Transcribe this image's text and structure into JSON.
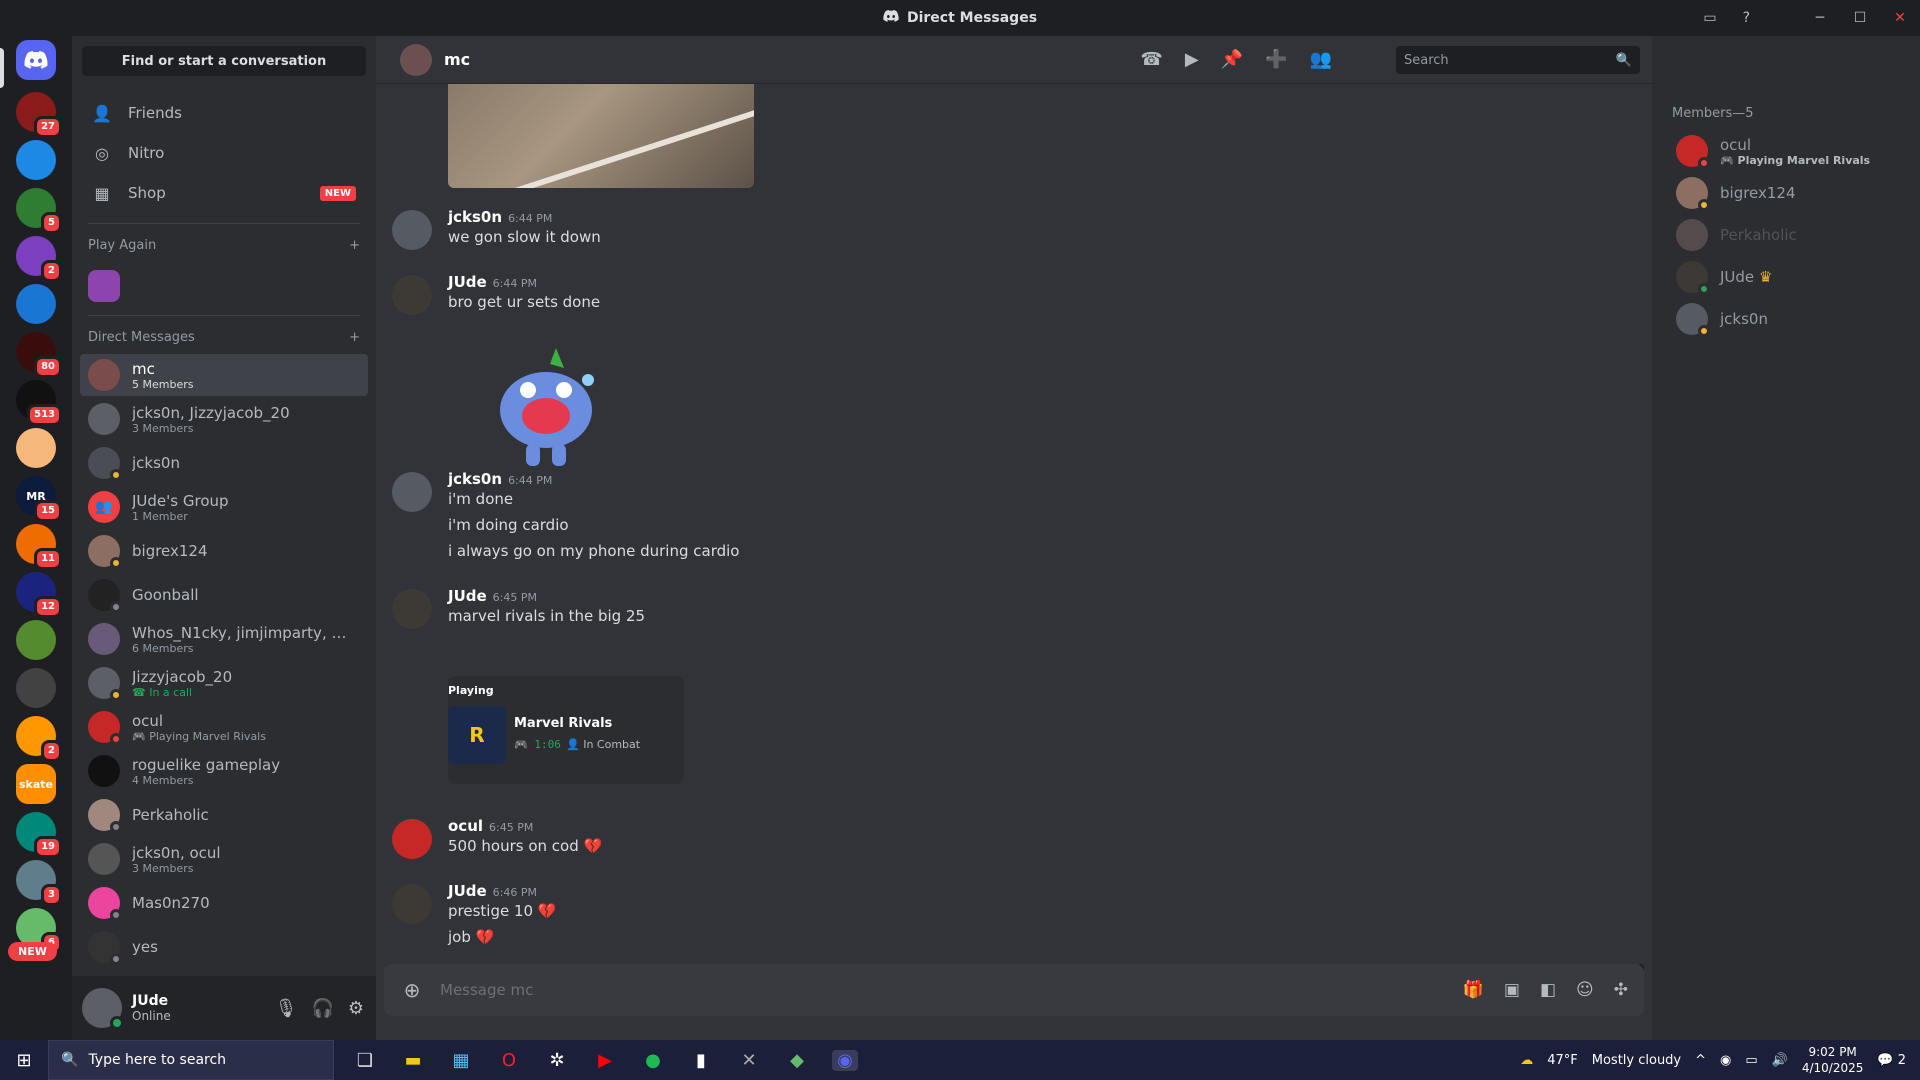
{
  "window": {
    "title": "Direct Messages"
  },
  "sidebar": {
    "find_placeholder": "Find or start a conversation",
    "nav": [
      {
        "label": "Friends"
      },
      {
        "label": "Nitro"
      },
      {
        "label": "Shop",
        "badge": "NEW"
      }
    ],
    "play_again_header": "Play Again",
    "dm_header": "Direct Messages",
    "dms": [
      {
        "name": "mc",
        "sub": "5 Members"
      },
      {
        "name": "jcks0n, Jizzyjacob_20",
        "sub": "3 Members"
      },
      {
        "name": "jcks0n",
        "sub": ""
      },
      {
        "name": "JUde's Group",
        "sub": "1 Member"
      },
      {
        "name": "bigrex124",
        "sub": ""
      },
      {
        "name": "Goonball",
        "sub": ""
      },
      {
        "name": "Whos_N1cky, jimjimparty, Luc...",
        "sub": "6 Members"
      },
      {
        "name": "Jizzyjacob_20",
        "sub": "In a call"
      },
      {
        "name": "ocul",
        "sub": "Playing Marvel Rivals"
      },
      {
        "name": "roguelike gameplay",
        "sub": "4 Members"
      },
      {
        "name": "Perkaholic",
        "sub": ""
      },
      {
        "name": "jcks0n, ocul",
        "sub": "3 Members"
      },
      {
        "name": "Mas0n270",
        "sub": ""
      },
      {
        "name": "yes",
        "sub": ""
      }
    ]
  },
  "guild_badges": [
    "27",
    "5",
    "2",
    "80",
    "513",
    "15",
    "11",
    "12",
    "2",
    "19",
    "3",
    "6"
  ],
  "guild_labels": {
    "skate": "skate",
    "new": "NEW",
    "mr": "MR"
  },
  "user": {
    "name": "JUde",
    "status": "Online"
  },
  "chat": {
    "name": "mc",
    "search_placeholder": "Search",
    "composer_placeholder": "Message mc",
    "messages": [
      {
        "author": "jcks0n",
        "time": "6:44 PM",
        "lines": [
          "we gon slow it down"
        ]
      },
      {
        "author": "JUde",
        "time": "6:44 PM",
        "lines": [
          "bro get ur sets done"
        ]
      },
      {
        "author": "jcks0n",
        "time": "6:44 PM",
        "lines": [
          "i'm done",
          "i'm doing cardio",
          "i always go on my phone during cardio"
        ]
      },
      {
        "author": "JUde",
        "time": "6:45 PM",
        "lines": [
          "marvel rivals in the big 25"
        ]
      },
      {
        "author": "ocul",
        "time": "6:45 PM",
        "lines": [
          "500 hours on cod"
        ]
      },
      {
        "author": "JUde",
        "time": "6:46 PM",
        "lines": [
          "prestige 10",
          "job"
        ]
      }
    ],
    "activity": {
      "label": "Playing",
      "game": "Marvel Rivals",
      "elapsed": "1:06",
      "state": "In Combat"
    }
  },
  "members": {
    "header": "Members—5",
    "list": [
      {
        "name": "ocul",
        "activity": "Playing Marvel Rivals"
      },
      {
        "name": "bigrex124",
        "activity": ""
      },
      {
        "name": "Perkaholic",
        "activity": ""
      },
      {
        "name": "JUde",
        "activity": ""
      },
      {
        "name": "jcks0n",
        "activity": ""
      }
    ]
  },
  "taskbar": {
    "search_placeholder": "Type here to search",
    "weather_temp": "47°F",
    "weather_text": "Mostly cloudy",
    "time": "9:02 PM",
    "date": "4/10/2025",
    "notif_count": "2"
  },
  "colors": {
    "accent": "#5865f2",
    "danger": "#f23f43",
    "online": "#23a55a",
    "idle": "#f0b232",
    "dnd": "#f23f43"
  }
}
